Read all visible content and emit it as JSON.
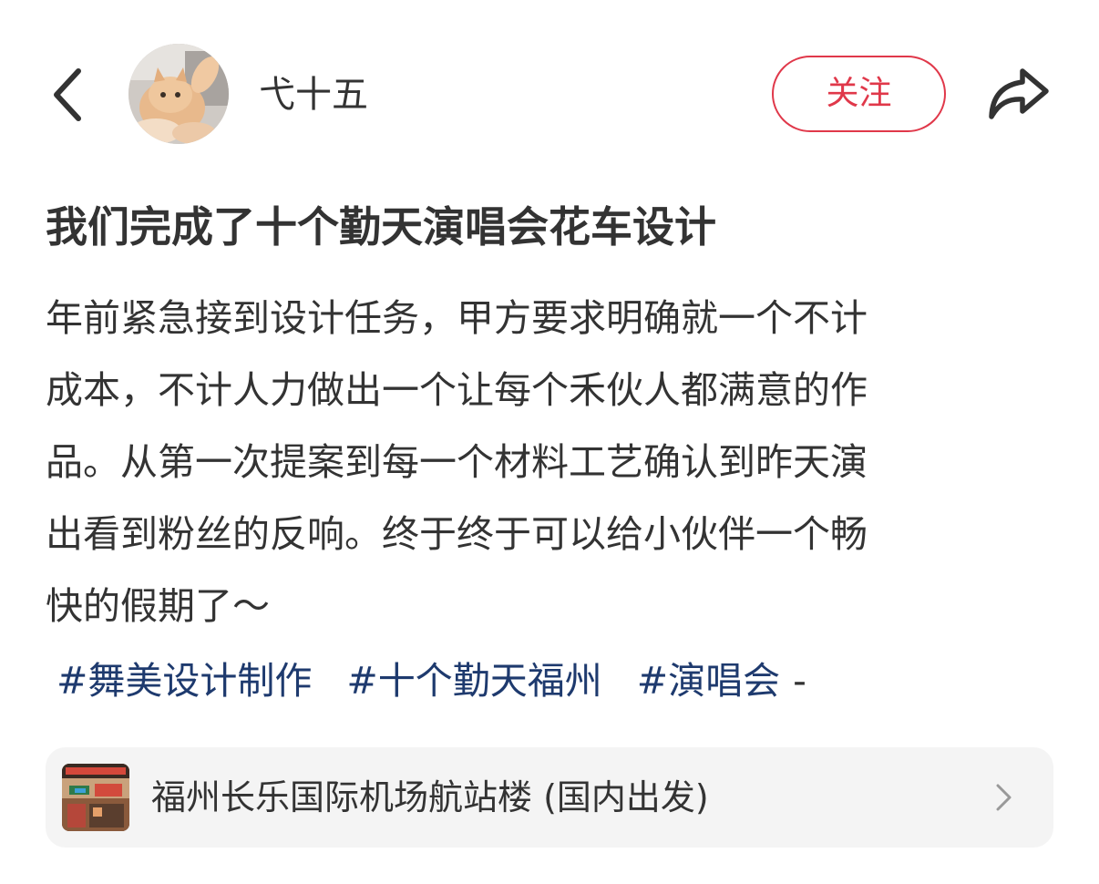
{
  "header": {
    "author_name": "弋十五",
    "follow_label": "关注",
    "follow_color": "#e0384a"
  },
  "post": {
    "title": "我们完成了十个勤天演唱会花车设计",
    "body_lines": [
      "年前紧急接到设计任务，甲方要求明确就一个不计",
      "成本，不计人力做出一个让每个禾伙人都满意的作",
      "品。从第一次提案到每一个材料工艺确认到昨天演",
      "出看到粉丝的反响。终于终于可以给小伙伴一个畅",
      "快的假期了～"
    ],
    "tags": [
      "#舞美设计制作",
      "#十个勤天福州",
      "#演唱会"
    ],
    "tag_trail": "-",
    "tag_color": "#1e3a6e"
  },
  "location": {
    "name": "福州长乐国际机场航站楼 (国内出发)"
  },
  "icons": {
    "back": "chevron-left-icon",
    "share": "share-arrow-icon",
    "location_arrow": "chevron-right-icon"
  }
}
